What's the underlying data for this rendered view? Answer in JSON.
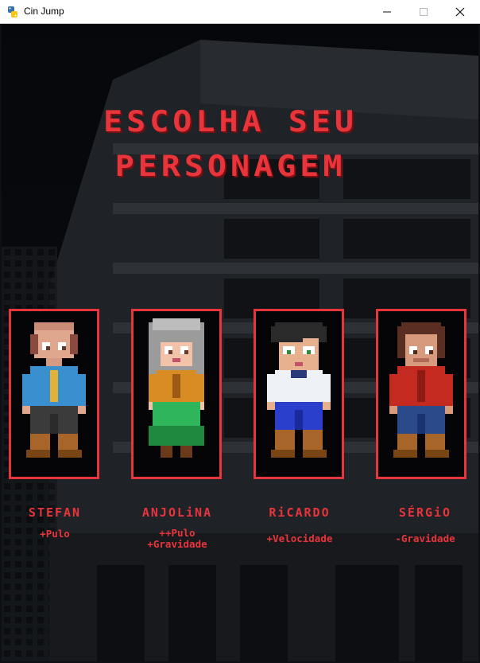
{
  "window": {
    "title": "Cin Jump",
    "icons": {
      "app": "python-icon",
      "minimize": "minimize-icon",
      "maximize": "maximize-icon",
      "close": "close-icon"
    }
  },
  "screen": {
    "title_line1": "ESCOLHA SEU",
    "title_line2": "PERSONAGEM",
    "accent_color": "#e8353b"
  },
  "characters": [
    {
      "name": "STEFAN",
      "bonus": [
        "+Pulo"
      ]
    },
    {
      "name": "ANJOLiNA",
      "bonus": [
        "++Pulo",
        "+Gravidade"
      ]
    },
    {
      "name": "RiCARDO",
      "bonus": [
        "+Velocidade"
      ]
    },
    {
      "name": "SÉRGiO",
      "bonus": [
        "-Gravidade"
      ]
    }
  ]
}
